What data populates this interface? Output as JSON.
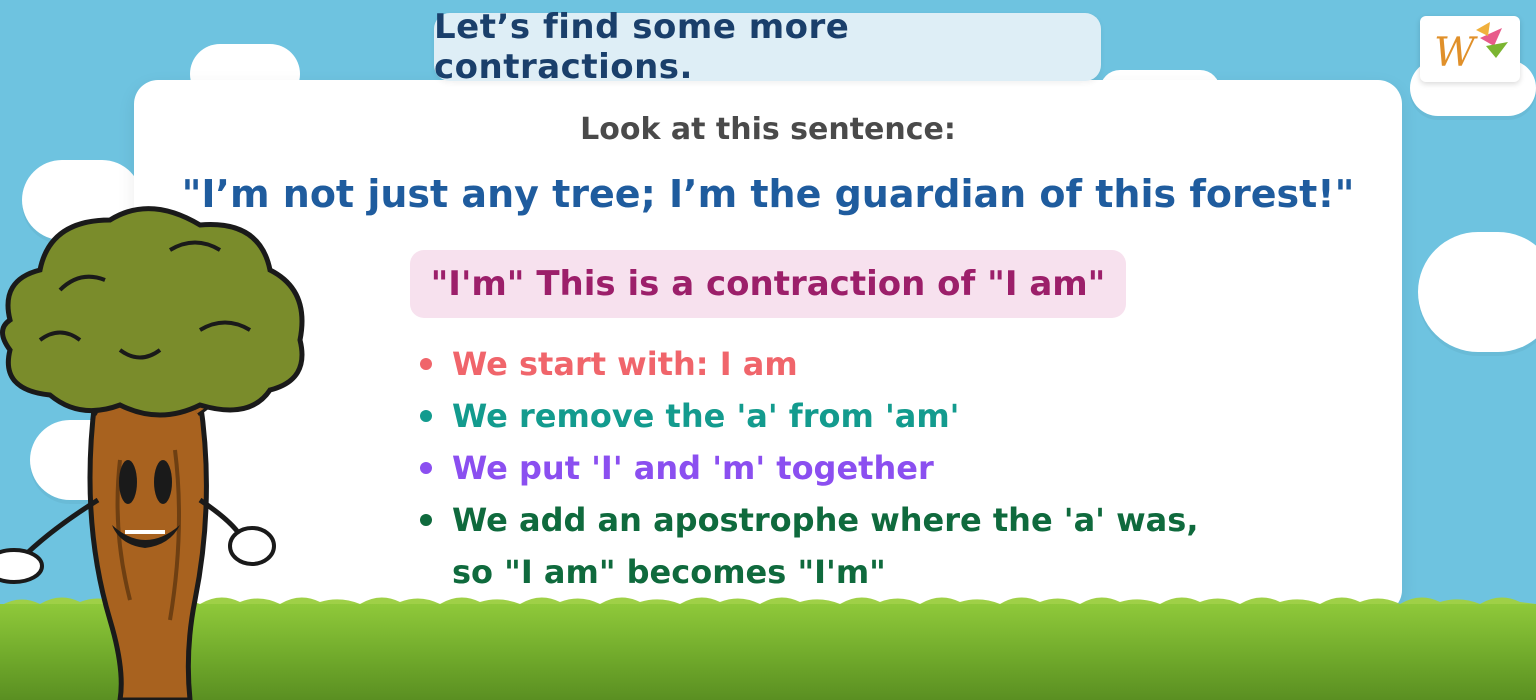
{
  "title": "Let’s find some more contractions.",
  "intro": "Look at this sentence:",
  "quote": "\"I’m not just any tree; I’m the guardian of this forest!\"",
  "contraction_note": "\"I'm\" This is a contraction of \"I am\"",
  "steps": [
    {
      "text": "We start with: I am",
      "color": "#f0656b"
    },
    {
      "text": "We remove the 'a' from 'am'",
      "color": "#139b8e"
    },
    {
      "text": "We put 'I' and 'm' together",
      "color": "#8b4ff0"
    },
    {
      "text": "We add an apostrophe where the 'a' was,",
      "text2": "so \"I am\" becomes \"I'm\"",
      "color": "#0f6a3d"
    }
  ],
  "logo_letter": "W",
  "colors": {
    "sky": "#6ec3e0",
    "title_pill": "#deeef6",
    "contraction_pill": "#f7e1ee",
    "grass": "#7bb531"
  }
}
